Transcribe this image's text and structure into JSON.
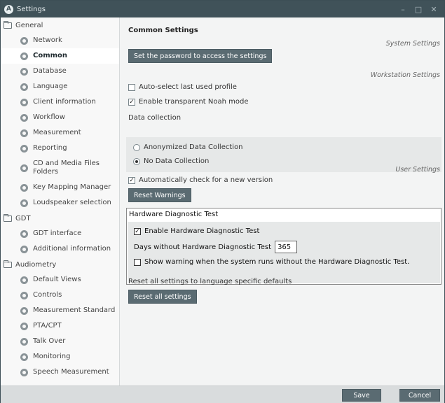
{
  "window": {
    "title": "Settings",
    "logo": "A",
    "minimize": "–",
    "maximize": "□",
    "close": "✕"
  },
  "sidebar": {
    "groups": [
      {
        "label": "General",
        "items": [
          "Network",
          "Common",
          "Database",
          "Language",
          "Client information",
          "Workflow",
          "Measurement",
          "Reporting",
          "CD and Media Files Folders",
          "Key Mapping Manager",
          "Loudspeaker selection"
        ]
      },
      {
        "label": "GDT",
        "items": [
          "GDT interface",
          "Additional information"
        ]
      },
      {
        "label": "Audiometry",
        "items": [
          "Default Views",
          "Controls",
          "Measurement Standard",
          "PTA/CPT",
          "Talk Over",
          "Monitoring",
          "Speech Measurement"
        ]
      }
    ],
    "selected": "Common"
  },
  "content": {
    "title": "Common Settings",
    "system_settings_label": "System Settings",
    "password_button": "Set the password to access the settings",
    "workstation_settings_label": "Workstation Settings",
    "auto_select_label": "Auto-select last used profile",
    "auto_select_checked": false,
    "transparent_noah_label": "Enable transparent Noah mode",
    "transparent_noah_checked": true,
    "data_collection_label": "Data collection",
    "data_collection_options": [
      "Anonymized Data Collection",
      "No Data Collection"
    ],
    "data_collection_selected": "No Data Collection",
    "user_settings_label": "User Settings",
    "auto_check_label": "Automatically check for a new version",
    "auto_check_checked": true,
    "reset_warnings_button": "Reset Warnings",
    "hardware_test": {
      "title": "Hardware Diagnostic Test",
      "enable_label": "Enable Hardware Diagnostic Test",
      "enable_checked": true,
      "days_label": "Days without Hardware Diagnostic Test",
      "days_value": "365",
      "warning_label": "Show warning when the system runs without the Hardware Diagnostic Test.",
      "warning_checked": false
    },
    "reset_defaults_label": "Reset all settings to language specific defaults",
    "reset_all_button": "Reset all settings"
  },
  "footer": {
    "save_button": "Save",
    "cancel_button": "Cancel"
  },
  "check_mark": "✓"
}
